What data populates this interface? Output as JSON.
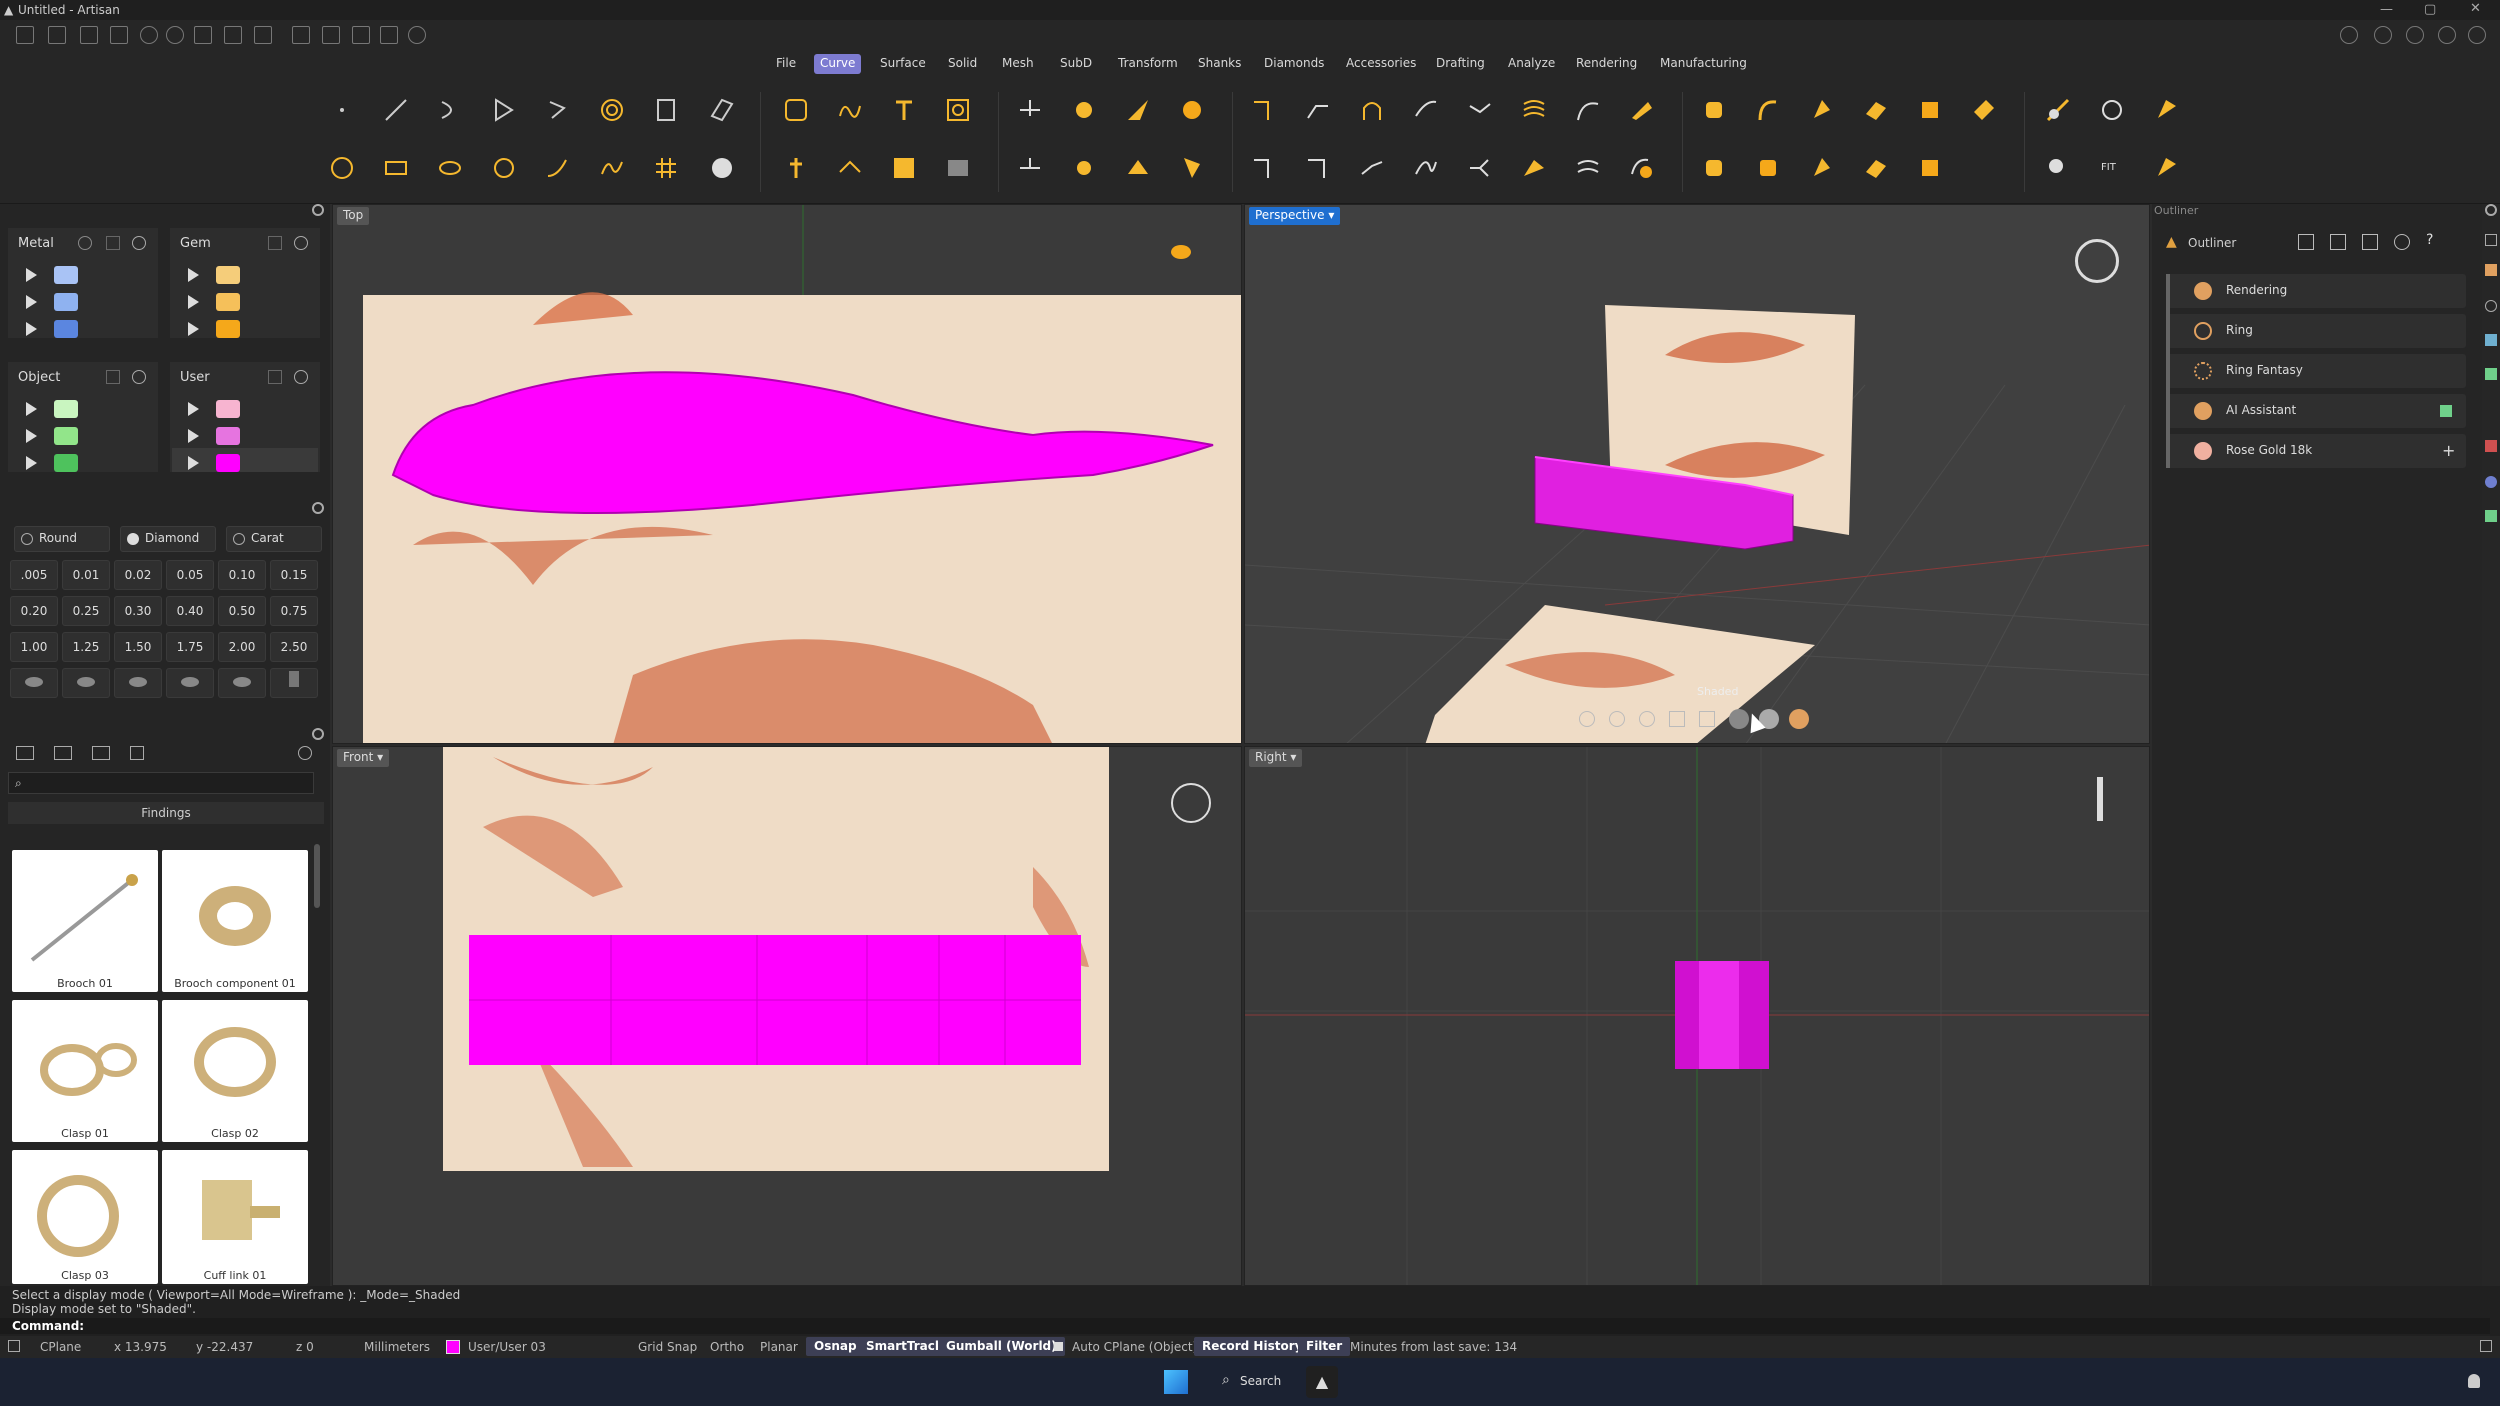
{
  "app": {
    "title": "Untitled - Artisan"
  },
  "menu": [
    "File",
    "Curve",
    "Surface",
    "Solid",
    "Mesh",
    "SubD",
    "Transform",
    "Shanks",
    "Diamonds",
    "Accessories",
    "Drafting",
    "Analyze",
    "Rendering",
    "Manufacturing"
  ],
  "active_menu": "Curve",
  "layers": {
    "metal_title": "Metal",
    "gem_title": "Gem",
    "object_title": "Object",
    "user_title": "User",
    "metal_colors": [
      "#a9c3f5",
      "#8fb2f0",
      "#5b86e0"
    ],
    "gem_colors": [
      "#f5cd7a",
      "#f5c05a",
      "#f5a81a"
    ],
    "object_colors": [
      "#c9f5c0",
      "#92e58a",
      "#4ec25d"
    ],
    "user_colors": [
      "#f7b4d0",
      "#e674e0",
      "#ff00ff"
    ]
  },
  "gem_sizes": {
    "tabs": [
      "Round",
      "Diamond",
      "Carat"
    ],
    "values": [
      ".005",
      "0.01",
      "0.02",
      "0.05",
      "0.10",
      "0.15",
      "0.20",
      "0.25",
      "0.30",
      "0.40",
      "0.50",
      "0.75",
      "1.00",
      "1.25",
      "1.50",
      "1.75",
      "2.00",
      "2.50"
    ]
  },
  "library": {
    "section": "Findings",
    "items": [
      "Brooch 01",
      "Brooch component 01",
      "Clasp 01",
      "Clasp 02",
      "Clasp 03",
      "Cuff link 01"
    ]
  },
  "viewports": {
    "top": "Top",
    "perspective": "Perspective",
    "front": "Front",
    "right": "Right",
    "overlay_label": "Shaded"
  },
  "outliner": {
    "panel_title": "Outliner",
    "header": "Outliner",
    "items": [
      "Rendering",
      "Ring",
      "Ring Fantasy",
      "AI Assistant",
      "Rose Gold 18k"
    ]
  },
  "command": {
    "line1": "Select a display mode ( Viewport=All  Mode=Wireframe ): _Mode=_Shaded",
    "line2": "Display mode set to \"Shaded\".",
    "prompt": "Command:"
  },
  "status": {
    "cplane": "CPlane",
    "x": "x 13.975",
    "y": "y -22.437",
    "z": "z 0",
    "units": "Millimeters",
    "layer": "User/User 03",
    "grid_snap": "Grid Snap",
    "ortho": "Ortho",
    "planar": "Planar",
    "osnap": "Osnap",
    "smarttrack": "SmartTrack",
    "gumball": "Gumball (World)",
    "auto_cplane": "Auto CPlane (Object)",
    "record_history": "Record History",
    "filter": "Filter",
    "last_save": "Minutes from last save: 134",
    "layer_color": "#ff00ff"
  },
  "taskbar": {
    "search": "Search"
  },
  "colors": {
    "accent": "#7d7bd1",
    "magenta": "#ff00ff",
    "active_viewport": "#1f6fd0"
  }
}
